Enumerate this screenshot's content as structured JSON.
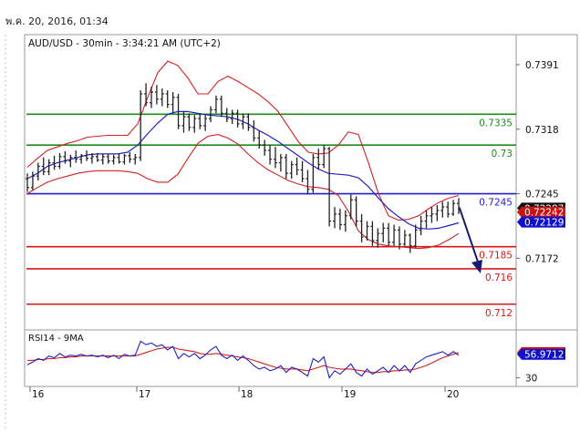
{
  "datestamp": "พ.ค. 20, 2016, 01:34",
  "chart_data": {
    "type": "candlestick",
    "title": "AUD/USD - 30min - 3:34:21 AM (UTC+2)",
    "x_day_labels": [
      "16",
      "17",
      "18",
      "19",
      "20"
    ],
    "price_axis": {
      "ticks": [
        0.7391,
        0.7318,
        0.7245,
        0.7172
      ],
      "tick_labels": [
        "0.7391",
        "0.7318",
        "0.7245",
        "0.7172"
      ],
      "range": [
        0.7095,
        0.7425
      ]
    },
    "levels": [
      {
        "label": "0.7335",
        "value": 0.7335,
        "color": "#1c8a1c"
      },
      {
        "label": "0.73",
        "value": 0.73,
        "color": "#1c8a1c"
      },
      {
        "label": "0.7245",
        "value": 0.7245,
        "color": "#1f1fd0"
      },
      {
        "label": "0.7185",
        "value": 0.7185,
        "color": "#d81818"
      },
      {
        "label": "0.716",
        "value": 0.716,
        "color": "#d81818"
      },
      {
        "label": "0.712",
        "value": 0.712,
        "color": "#d81818"
      }
    ],
    "price_tags": [
      {
        "label": "0.72287",
        "value": 0.72287,
        "bg": "#111111",
        "fg": "#ffffff"
      },
      {
        "label": "0.72242",
        "value": 0.72242,
        "bg": "#cc1111",
        "fg": "#ffffff"
      },
      {
        "label": "0.72129",
        "value": 0.72129,
        "bg": "#1111cc",
        "fg": "#ffffff"
      }
    ],
    "bands": {
      "upper": [
        0.7275,
        0.7285,
        0.7294,
        0.7298,
        0.7302,
        0.7305,
        0.7309,
        0.731,
        0.7311,
        0.7311,
        0.7311,
        0.7324,
        0.7354,
        0.7382,
        0.7395,
        0.739,
        0.7376,
        0.7358,
        0.7358,
        0.7372,
        0.7378,
        0.7372,
        0.7365,
        0.7358,
        0.7349,
        0.7338,
        0.7321,
        0.7304,
        0.7292,
        0.729,
        0.7291,
        0.73,
        0.7315,
        0.7312,
        0.728,
        0.7245,
        0.722,
        0.7215,
        0.7216,
        0.722,
        0.7228,
        0.7235,
        0.724,
        0.7243
      ],
      "middle": [
        0.7262,
        0.7268,
        0.7276,
        0.728,
        0.7283,
        0.7286,
        0.7289,
        0.729,
        0.729,
        0.729,
        0.7292,
        0.73,
        0.7313,
        0.7325,
        0.7335,
        0.7338,
        0.7338,
        0.7336,
        0.7334,
        0.7333,
        0.7332,
        0.7329,
        0.7324,
        0.7317,
        0.7311,
        0.7304,
        0.7296,
        0.7288,
        0.728,
        0.7273,
        0.7268,
        0.7267,
        0.7266,
        0.7263,
        0.7253,
        0.724,
        0.7228,
        0.7219,
        0.7211,
        0.7206,
        0.7205,
        0.7206,
        0.7209,
        0.7212
      ],
      "lower": [
        0.7245,
        0.7252,
        0.7258,
        0.7262,
        0.7265,
        0.7268,
        0.727,
        0.7271,
        0.7271,
        0.7271,
        0.727,
        0.7268,
        0.7262,
        0.7258,
        0.7258,
        0.7267,
        0.7285,
        0.7302,
        0.731,
        0.7312,
        0.7308,
        0.7301,
        0.729,
        0.728,
        0.7272,
        0.7266,
        0.726,
        0.7256,
        0.7253,
        0.7252,
        0.725,
        0.7243,
        0.7225,
        0.7203,
        0.7193,
        0.7188,
        0.7186,
        0.7185,
        0.7184,
        0.7183,
        0.7184,
        0.7187,
        0.7193,
        0.72
      ]
    },
    "candles": [
      [
        0.7262,
        0.7268,
        0.7247,
        0.7252
      ],
      [
        0.7252,
        0.727,
        0.7249,
        0.7265
      ],
      [
        0.7265,
        0.728,
        0.726,
        0.7276
      ],
      [
        0.7276,
        0.7286,
        0.7266,
        0.727
      ],
      [
        0.727,
        0.7284,
        0.7266,
        0.728
      ],
      [
        0.728,
        0.7288,
        0.7272,
        0.7276
      ],
      [
        0.7276,
        0.7291,
        0.7273,
        0.7287
      ],
      [
        0.7287,
        0.7293,
        0.7279,
        0.7282
      ],
      [
        0.7282,
        0.7289,
        0.7275,
        0.7286
      ],
      [
        0.7286,
        0.7294,
        0.728,
        0.7284
      ],
      [
        0.7284,
        0.729,
        0.7279,
        0.7288
      ],
      [
        0.7288,
        0.7294,
        0.7282,
        0.7285
      ],
      [
        0.7285,
        0.7291,
        0.7279,
        0.7287
      ],
      [
        0.7287,
        0.7291,
        0.7281,
        0.7283
      ],
      [
        0.7283,
        0.729,
        0.7278,
        0.7287
      ],
      [
        0.7287,
        0.729,
        0.7279,
        0.7282
      ],
      [
        0.7282,
        0.7289,
        0.7278,
        0.7286
      ],
      [
        0.7286,
        0.729,
        0.7279,
        0.7281
      ],
      [
        0.7281,
        0.729,
        0.7278,
        0.7288
      ],
      [
        0.7288,
        0.7292,
        0.728,
        0.7284
      ],
      [
        0.7284,
        0.729,
        0.7278,
        0.7286
      ],
      [
        0.7286,
        0.7362,
        0.7282,
        0.7358
      ],
      [
        0.7358,
        0.737,
        0.7344,
        0.7348
      ],
      [
        0.7348,
        0.7366,
        0.7342,
        0.736
      ],
      [
        0.736,
        0.7368,
        0.7346,
        0.7352
      ],
      [
        0.7352,
        0.7364,
        0.7344,
        0.7358
      ],
      [
        0.7358,
        0.7362,
        0.7342,
        0.7346
      ],
      [
        0.7346,
        0.736,
        0.7336,
        0.7354
      ],
      [
        0.7354,
        0.7358,
        0.7318,
        0.7322
      ],
      [
        0.7322,
        0.7338,
        0.7314,
        0.7332
      ],
      [
        0.7332,
        0.7336,
        0.7316,
        0.732
      ],
      [
        0.732,
        0.7334,
        0.7314,
        0.733
      ],
      [
        0.733,
        0.7336,
        0.7318,
        0.7322
      ],
      [
        0.7322,
        0.7334,
        0.7316,
        0.733
      ],
      [
        0.733,
        0.7344,
        0.7326,
        0.734
      ],
      [
        0.734,
        0.7356,
        0.7336,
        0.7352
      ],
      [
        0.7352,
        0.7356,
        0.7332,
        0.7336
      ],
      [
        0.7336,
        0.7342,
        0.7326,
        0.733
      ],
      [
        0.733,
        0.734,
        0.7324,
        0.7336
      ],
      [
        0.7336,
        0.734,
        0.732,
        0.7324
      ],
      [
        0.7324,
        0.7336,
        0.7318,
        0.7332
      ],
      [
        0.7332,
        0.7336,
        0.7316,
        0.732
      ],
      [
        0.732,
        0.7328,
        0.7304,
        0.7308
      ],
      [
        0.7308,
        0.7316,
        0.7296,
        0.73
      ],
      [
        0.73,
        0.7306,
        0.7288,
        0.7294
      ],
      [
        0.7294,
        0.73,
        0.7278,
        0.7284
      ],
      [
        0.7284,
        0.7298,
        0.7274,
        0.728
      ],
      [
        0.728,
        0.729,
        0.727,
        0.7286
      ],
      [
        0.7286,
        0.729,
        0.7262,
        0.7268
      ],
      [
        0.7268,
        0.7282,
        0.7262,
        0.7278
      ],
      [
        0.7278,
        0.7286,
        0.7266,
        0.7272
      ],
      [
        0.7272,
        0.7282,
        0.7258,
        0.7262
      ],
      [
        0.7262,
        0.7272,
        0.7244,
        0.725
      ],
      [
        0.725,
        0.729,
        0.7246,
        0.7286
      ],
      [
        0.7286,
        0.7296,
        0.7272,
        0.7278
      ],
      [
        0.7278,
        0.73,
        0.7274,
        0.7296
      ],
      [
        0.7296,
        0.7298,
        0.7208,
        0.7214
      ],
      [
        0.7214,
        0.723,
        0.7206,
        0.7222
      ],
      [
        0.7222,
        0.7228,
        0.7204,
        0.721
      ],
      [
        0.721,
        0.7226,
        0.7202,
        0.722
      ],
      [
        0.722,
        0.7244,
        0.7216,
        0.7238
      ],
      [
        0.7238,
        0.7242,
        0.7208,
        0.7214
      ],
      [
        0.7214,
        0.7222,
        0.719,
        0.7196
      ],
      [
        0.7196,
        0.7214,
        0.7192,
        0.7208
      ],
      [
        0.7208,
        0.7214,
        0.7186,
        0.7192
      ],
      [
        0.7192,
        0.7206,
        0.7184,
        0.72
      ],
      [
        0.72,
        0.7212,
        0.719,
        0.7206
      ],
      [
        0.7206,
        0.7212,
        0.7186,
        0.719
      ],
      [
        0.719,
        0.721,
        0.7186,
        0.7204
      ],
      [
        0.7204,
        0.7208,
        0.7182,
        0.7188
      ],
      [
        0.7188,
        0.7204,
        0.7186,
        0.7198
      ],
      [
        0.7198,
        0.72,
        0.7178,
        0.7186
      ],
      [
        0.7186,
        0.721,
        0.7184,
        0.7204
      ],
      [
        0.7204,
        0.722,
        0.7198,
        0.7214
      ],
      [
        0.7214,
        0.7226,
        0.7206,
        0.722
      ],
      [
        0.722,
        0.723,
        0.7212,
        0.7222
      ],
      [
        0.7222,
        0.7232,
        0.7214,
        0.7226
      ],
      [
        0.7226,
        0.7236,
        0.7218,
        0.723
      ],
      [
        0.723,
        0.7236,
        0.7218,
        0.7222
      ],
      [
        0.7222,
        0.7238,
        0.722,
        0.7234
      ],
      [
        0.7234,
        0.724,
        0.7222,
        0.7229
      ]
    ],
    "rsi": {
      "label": "RSI14 - 9MA",
      "axis_ticks": [
        30
      ],
      "range": [
        20,
        85
      ],
      "tags": [
        {
          "label": "58.9295",
          "value": 58.93,
          "bg": "#cc1111",
          "fg": "#ffffff"
        },
        {
          "label": "56.9712",
          "value": 56.97,
          "bg": "#1111cc",
          "fg": "#ffffff"
        }
      ],
      "rsi_values": [
        45,
        48,
        52,
        50,
        55,
        53,
        58,
        54,
        56,
        55,
        57,
        55,
        56,
        54,
        56,
        53,
        56,
        52,
        57,
        55,
        56,
        72,
        68,
        70,
        66,
        68,
        62,
        66,
        52,
        58,
        54,
        58,
        52,
        56,
        62,
        66,
        56,
        52,
        56,
        50,
        55,
        50,
        44,
        40,
        42,
        38,
        40,
        44,
        36,
        42,
        40,
        36,
        32,
        52,
        48,
        54,
        30,
        38,
        34,
        40,
        46,
        36,
        32,
        40,
        34,
        38,
        42,
        36,
        44,
        38,
        44,
        36,
        46,
        50,
        54,
        56,
        58,
        60,
        56,
        60,
        56
      ],
      "ma_values": [
        50,
        50,
        51,
        51,
        52,
        52,
        53,
        53,
        54,
        54,
        55,
        55,
        55,
        55,
        55,
        55,
        55,
        55,
        55,
        55,
        55,
        57,
        59,
        61,
        63,
        64,
        65,
        65,
        63,
        62,
        61,
        60,
        58,
        57,
        57,
        58,
        57,
        56,
        55,
        54,
        53,
        52,
        50,
        48,
        46,
        44,
        42,
        41,
        40,
        40,
        40,
        39,
        38,
        40,
        42,
        44,
        42,
        41,
        40,
        40,
        40,
        39,
        38,
        37,
        36,
        36,
        37,
        37,
        38,
        38,
        39,
        39,
        40,
        42,
        44,
        47,
        50,
        53,
        55,
        57,
        58.9
      ]
    }
  }
}
